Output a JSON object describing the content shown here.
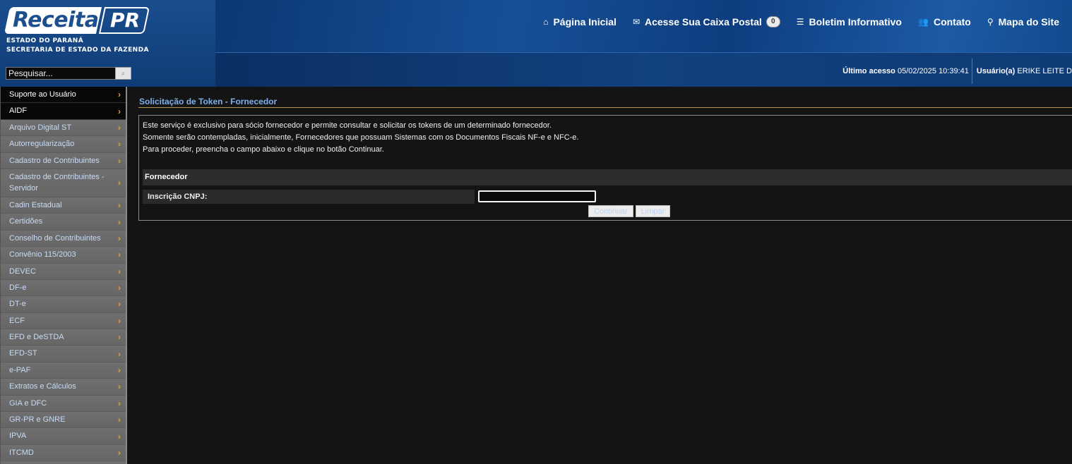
{
  "header": {
    "logo_receita": "Receita",
    "logo_pr": "PR",
    "logo_line1": "ESTADO DO PARANÁ",
    "logo_line2": "SECRETARIA DE ESTADO DA FAZENDA",
    "search_placeholder": "Pesquisar...",
    "search_button_icon": "magnifier-icon",
    "nav": [
      {
        "label": "Página Inicial",
        "icon": "home-icon"
      },
      {
        "label": "Acesse Sua Caixa Postal",
        "icon": "envelope-icon",
        "badge": "0"
      },
      {
        "label": "Boletim Informativo",
        "icon": "list-icon"
      },
      {
        "label": "Contato",
        "icon": "users-icon"
      },
      {
        "label": "Mapa do Site",
        "icon": "map-marker-icon"
      }
    ],
    "last_access_label": "Último acesso",
    "last_access_value": "05/02/2025 10:39:41",
    "user_label": "Usuário(a)",
    "user_value": "ERIKE LEITE D"
  },
  "sidebar": {
    "items": [
      {
        "label": "Suporte ao Usuário",
        "style": "dark"
      },
      {
        "label": "AIDF",
        "style": "dark"
      },
      {
        "label": "Arquivo Digital ST"
      },
      {
        "label": "Autorregularização"
      },
      {
        "label": "Cadastro de Contribuintes"
      },
      {
        "label": "Cadastro de Contribuintes - Servidor",
        "tall": true
      },
      {
        "label": "Cadin Estadual"
      },
      {
        "label": "Certidões"
      },
      {
        "label": "Conselho de Contribuintes"
      },
      {
        "label": "Convênio 115/2003"
      },
      {
        "label": "DEVEC"
      },
      {
        "label": "DF-e"
      },
      {
        "label": "DT-e"
      },
      {
        "label": "ECF"
      },
      {
        "label": "EFD e DeSTDA"
      },
      {
        "label": "EFD-ST"
      },
      {
        "label": "e-PAF"
      },
      {
        "label": "Extratos e Cálculos"
      },
      {
        "label": "GIA e DFC"
      },
      {
        "label": "GR-PR e GNRE"
      },
      {
        "label": "IPVA"
      },
      {
        "label": "ITCMD"
      }
    ]
  },
  "main": {
    "title": "Solicitação de Token - Fornecedor",
    "intro_lines": [
      "Este serviço é exclusivo para sócio fornecedor e permite consultar e solicitar os tokens de um determinado fornecedor.",
      "Somente serão contempladas, inicialmente, Fornecedores que possuam Sistemas com os Documentos Fiscais NF-e e NFC-e.",
      "Para proceder, preencha o campo abaixo e clique no botão Continuar."
    ],
    "section_title": "Fornecedor",
    "cnpj_label": "Inscrição CNPJ:",
    "cnpj_value": "",
    "continue_label": "Continuar",
    "clear_label": "Limpar"
  },
  "colors": {
    "header_blue": "#0f3f7c",
    "title_blue": "#7fb0ee",
    "chevron_orange": "#f0a030",
    "sidebar_gray": "#6e6e6e"
  }
}
